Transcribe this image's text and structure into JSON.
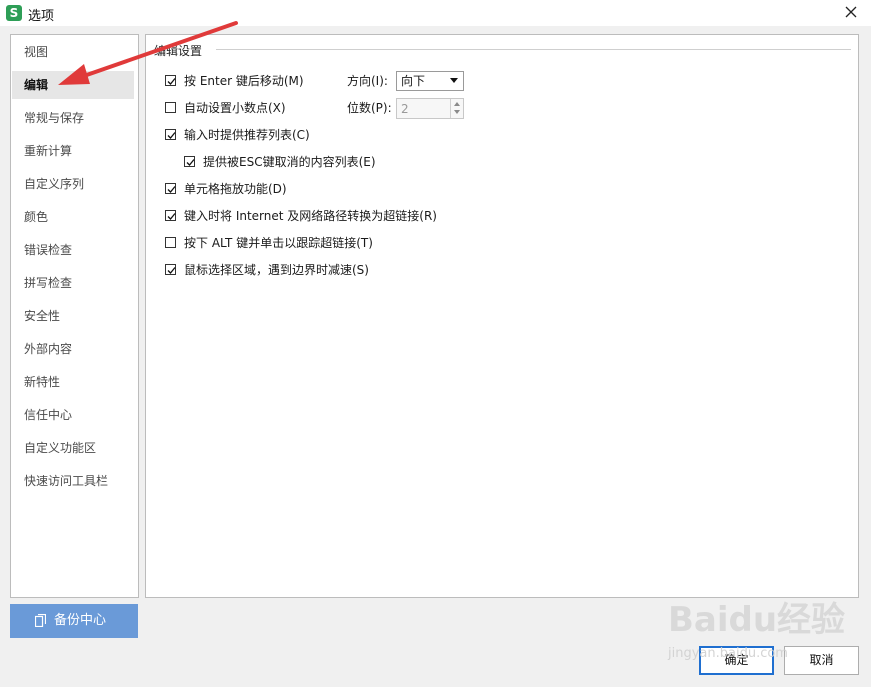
{
  "window": {
    "title": "选项",
    "app_icon": "S",
    "close_icon": "close-icon"
  },
  "sidebar": {
    "items": [
      {
        "label": "视图"
      },
      {
        "label": "编辑",
        "active": true
      },
      {
        "label": "常规与保存"
      },
      {
        "label": "重新计算"
      },
      {
        "label": "自定义序列"
      },
      {
        "label": "颜色"
      },
      {
        "label": "错误检查"
      },
      {
        "label": "拼写检查"
      },
      {
        "label": "安全性"
      },
      {
        "label": "外部内容"
      },
      {
        "label": "新特性"
      },
      {
        "label": "信任中心"
      },
      {
        "label": "自定义功能区"
      },
      {
        "label": "快速访问工具栏"
      }
    ],
    "backup_label": "备份中心"
  },
  "edit_settings": {
    "group_title": "编辑设置",
    "options": [
      {
        "label": "按 Enter 键后移动(M)",
        "checked": true
      },
      {
        "label": "自动设置小数点(X)",
        "checked": false
      },
      {
        "label": "输入时提供推荐列表(C)",
        "checked": true
      },
      {
        "label": "提供被ESC键取消的内容列表(E)",
        "checked": true
      },
      {
        "label": "单元格拖放功能(D)",
        "checked": true
      },
      {
        "label": "键入时将 Internet 及网络路径转换为超链接(R)",
        "checked": true
      },
      {
        "label": "按下 ALT 键并单击以跟踪超链接(T)",
        "checked": false
      },
      {
        "label": "鼠标选择区域，遇到边界时减速(S)",
        "checked": true
      }
    ],
    "direction_label": "方向(I):",
    "direction_value": "向下",
    "decimals_label": "位数(P):",
    "decimals_value": "2"
  },
  "buttons": {
    "ok": "确定",
    "cancel": "取消"
  },
  "watermark": {
    "text": "Baidu经验",
    "sub": "jingyan.baidu.com"
  },
  "colors": {
    "accent": "#6a9ad8",
    "arrow": "#e03a3a",
    "app_icon": "#2e9e57"
  }
}
